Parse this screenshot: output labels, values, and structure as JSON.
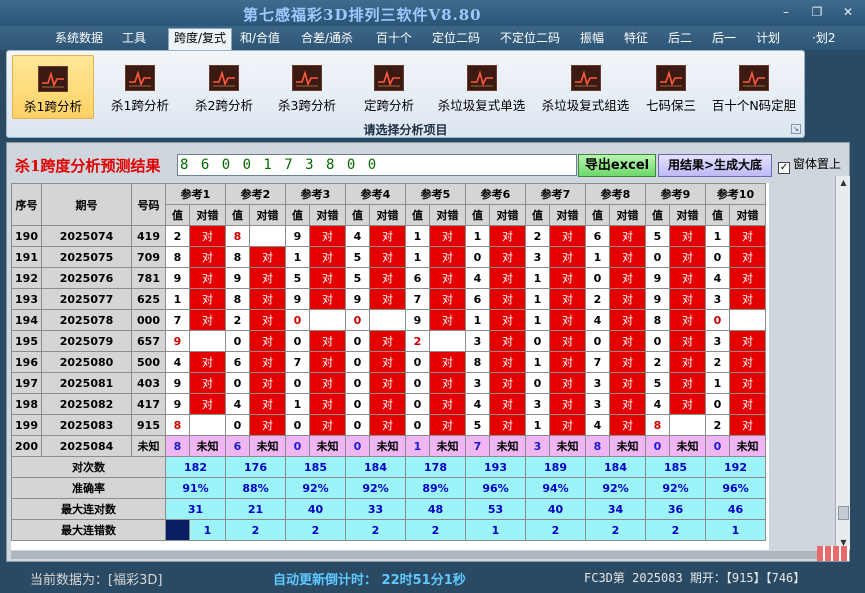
{
  "window": {
    "title": "第七感福彩3D排列三软件V8.80",
    "minimize": "–",
    "restore": "❐",
    "close": "✕"
  },
  "menu": [
    {
      "label": "系统数据"
    },
    {
      "label": "工具"
    },
    {
      "label": "跨度/复式",
      "active": true
    },
    {
      "label": "和/合值"
    },
    {
      "label": "合差/通杀"
    },
    {
      "label": "百十个"
    },
    {
      "label": "定位二码"
    },
    {
      "label": "不定位二码"
    },
    {
      "label": "振幅"
    },
    {
      "label": "特征"
    },
    {
      "label": "后二"
    },
    {
      "label": "后一"
    },
    {
      "label": "计划"
    },
    {
      "label": "·划2"
    }
  ],
  "ribbon": {
    "buttons": [
      {
        "label": "杀1跨分析",
        "active": true
      },
      {
        "label": "杀1跨分析"
      },
      {
        "label": "杀2跨分析"
      },
      {
        "label": "杀3跨分析"
      },
      {
        "label": "定跨分析"
      },
      {
        "label": "杀垃圾复式单选"
      },
      {
        "label": "杀垃圾复式组选"
      },
      {
        "label": "七码保三"
      },
      {
        "label": "百十个N码定胆"
      }
    ],
    "caption": "请选择分析项目",
    "expand": "↘"
  },
  "result": {
    "title": "杀1跨度分析预测结果",
    "value": "8 6 0 0 1 7 3 8 0 0",
    "export_label": "导出excel",
    "generate_label": "用结果>生成大底",
    "ontop_label": "窗体置上",
    "ontop_checked": "✓"
  },
  "grid": {
    "col_headers": {
      "seq": "序号",
      "issue": "期号",
      "number": "号码"
    },
    "ref_headers": [
      "参考1",
      "参考2",
      "参考3",
      "参考4",
      "参考5",
      "参考6",
      "参考7",
      "参考8",
      "参考9",
      "参考10"
    ],
    "sub_headers": {
      "value": "值",
      "check": "对错"
    },
    "hit_label": "对",
    "rows": [
      {
        "seq": "190",
        "issue": "2025074",
        "number": "419",
        "vals": [
          "2",
          "8",
          "9",
          "4",
          "1",
          "1",
          "2",
          "6",
          "5",
          "1"
        ],
        "hits": [
          1,
          0,
          1,
          1,
          1,
          1,
          1,
          1,
          1,
          1
        ]
      },
      {
        "seq": "191",
        "issue": "2025075",
        "number": "709",
        "vals": [
          "8",
          "8",
          "1",
          "5",
          "1",
          "0",
          "3",
          "1",
          "0",
          "0"
        ],
        "hits": [
          1,
          1,
          1,
          1,
          1,
          1,
          1,
          1,
          1,
          1
        ]
      },
      {
        "seq": "192",
        "issue": "2025076",
        "number": "781",
        "vals": [
          "9",
          "9",
          "5",
          "5",
          "6",
          "4",
          "1",
          "0",
          "9",
          "4"
        ],
        "hits": [
          1,
          1,
          1,
          1,
          1,
          1,
          1,
          1,
          1,
          1
        ]
      },
      {
        "seq": "193",
        "issue": "2025077",
        "number": "625",
        "vals": [
          "1",
          "8",
          "9",
          "9",
          "7",
          "6",
          "1",
          "2",
          "9",
          "3"
        ],
        "hits": [
          1,
          1,
          1,
          1,
          1,
          1,
          1,
          1,
          1,
          1
        ]
      },
      {
        "seq": "194",
        "issue": "2025078",
        "number": "000",
        "vals": [
          "7",
          "2",
          "0",
          "0",
          "9",
          "1",
          "1",
          "4",
          "8",
          "0"
        ],
        "hits": [
          1,
          1,
          0,
          0,
          1,
          1,
          1,
          1,
          1,
          0
        ]
      },
      {
        "seq": "195",
        "issue": "2025079",
        "number": "657",
        "vals": [
          "9",
          "0",
          "0",
          "0",
          "2",
          "3",
          "0",
          "0",
          "0",
          "3"
        ],
        "hits": [
          0,
          1,
          1,
          1,
          0,
          1,
          1,
          1,
          1,
          1
        ]
      },
      {
        "seq": "196",
        "issue": "2025080",
        "number": "500",
        "vals": [
          "4",
          "6",
          "7",
          "0",
          "0",
          "8",
          "1",
          "7",
          "2",
          "2"
        ],
        "hits": [
          1,
          1,
          1,
          1,
          1,
          1,
          1,
          1,
          1,
          1
        ]
      },
      {
        "seq": "197",
        "issue": "2025081",
        "number": "403",
        "vals": [
          "9",
          "0",
          "0",
          "0",
          "0",
          "3",
          "0",
          "3",
          "5",
          "1"
        ],
        "hits": [
          1,
          1,
          1,
          1,
          1,
          1,
          1,
          1,
          1,
          1
        ]
      },
      {
        "seq": "198",
        "issue": "2025082",
        "number": "417",
        "vals": [
          "9",
          "4",
          "1",
          "0",
          "0",
          "4",
          "3",
          "3",
          "4",
          "0"
        ],
        "hits": [
          1,
          1,
          1,
          1,
          1,
          1,
          1,
          1,
          1,
          1
        ]
      },
      {
        "seq": "199",
        "issue": "2025083",
        "number": "915",
        "vals": [
          "8",
          "0",
          "0",
          "0",
          "0",
          "5",
          "1",
          "4",
          "8",
          "2"
        ],
        "hits": [
          0,
          1,
          1,
          1,
          1,
          1,
          1,
          1,
          0,
          1
        ]
      }
    ],
    "unknown_row": {
      "seq": "200",
      "issue": "2025084",
      "number": "未知",
      "vals": [
        "8",
        "6",
        "0",
        "0",
        "1",
        "7",
        "3",
        "8",
        "0",
        "0"
      ],
      "label": "未知"
    },
    "stats": [
      {
        "label": "对次数",
        "values": [
          "182",
          "176",
          "185",
          "184",
          "178",
          "193",
          "189",
          "184",
          "185",
          "192"
        ]
      },
      {
        "label": "准确率",
        "values": [
          "91%",
          "88%",
          "92%",
          "92%",
          "89%",
          "96%",
          "94%",
          "92%",
          "92%",
          "96%"
        ]
      },
      {
        "label": "最大连对数",
        "values": [
          "31",
          "21",
          "40",
          "33",
          "48",
          "53",
          "40",
          "34",
          "36",
          "46"
        ]
      },
      {
        "label": "最大连错数",
        "values": [
          "1",
          "2",
          "2",
          "2",
          "2",
          "1",
          "2",
          "2",
          "2",
          "1"
        ]
      }
    ]
  },
  "status": {
    "source": "当前数据为：[福彩3D]",
    "countdown": "自动更新倒计时：  22时51分1秒",
    "issue": "FC3D第 2025083 期开：【915】【746】"
  },
  "colors": {
    "hit": "#e40000",
    "unknown": "#f0b6f4",
    "stat": "#9cf3f8",
    "title_red": "#e00000"
  }
}
